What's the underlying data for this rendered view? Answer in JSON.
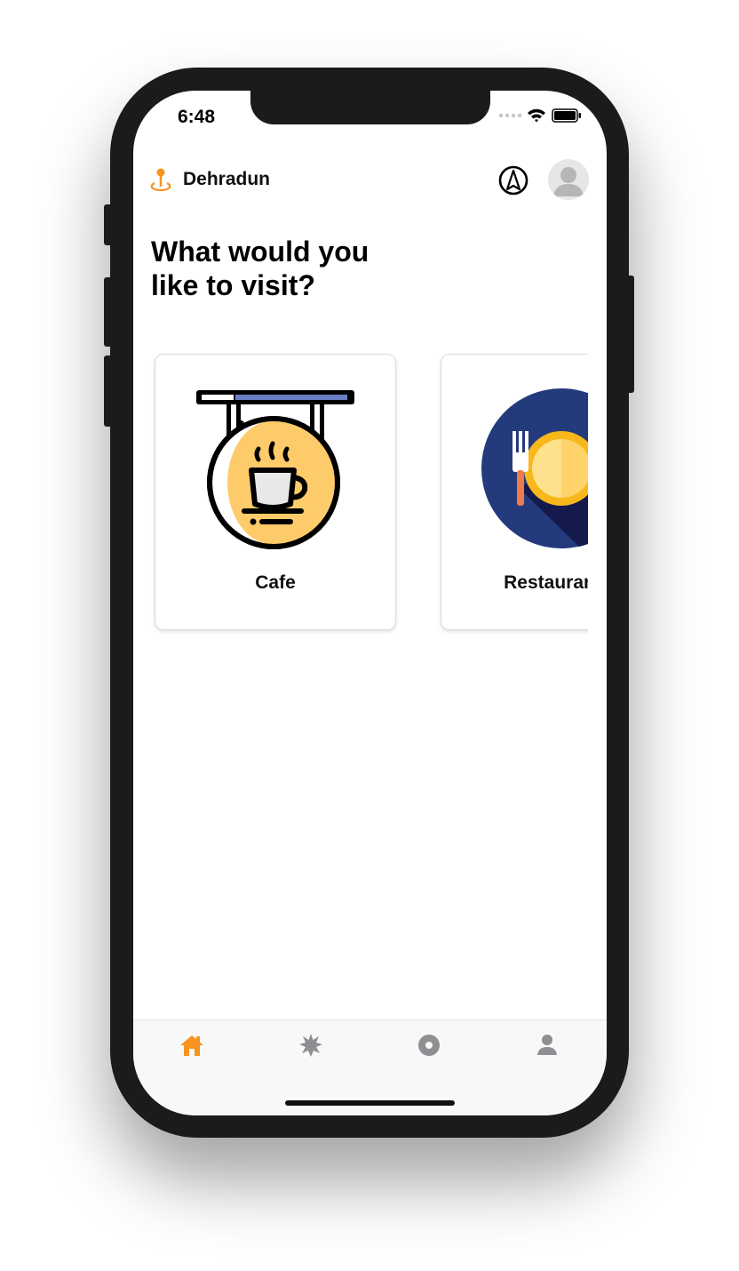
{
  "status_bar": {
    "time": "6:48"
  },
  "header": {
    "location": "Dehradun",
    "icons": [
      "location-pin-icon",
      "compass-icon",
      "avatar"
    ]
  },
  "main": {
    "heading_line1": "What would you",
    "heading_line2": "like to visit?",
    "categories": [
      {
        "label": "Cafe",
        "icon": "cafe-sign-icon"
      },
      {
        "label": "Restaurant",
        "icon": "restaurant-plate-icon"
      }
    ]
  },
  "tabbar": {
    "tabs": [
      {
        "icon": "home-icon",
        "active": true
      },
      {
        "icon": "star-icon",
        "active": false
      },
      {
        "icon": "record-icon",
        "active": false
      },
      {
        "icon": "profile-icon",
        "active": false
      }
    ],
    "active_color": "#f7931e",
    "inactive_color": "#8e8e93"
  },
  "colors": {
    "accent": "#f7931e",
    "navy": "#233a7c"
  }
}
